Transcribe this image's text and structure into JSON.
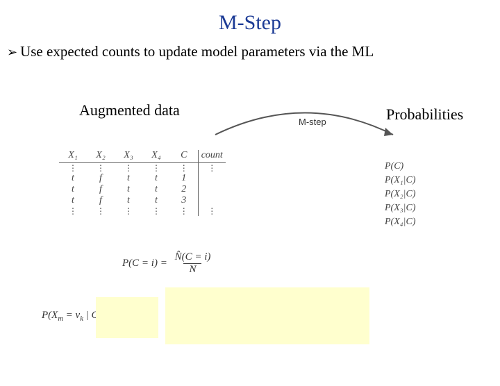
{
  "title": "M-Step",
  "bullet": "Use expected counts to update model parameters via the ML",
  "labels": {
    "augmented": "Augmented data",
    "probabilities": "Probabilities",
    "mstep": "M-step"
  },
  "table": {
    "headers": [
      "X₁",
      "X₂",
      "X₃",
      "X₄",
      "C",
      "count"
    ],
    "rows": [
      [
        "t",
        "f",
        "t",
        "t",
        "1"
      ],
      [
        "t",
        "f",
        "t",
        "t",
        "2"
      ],
      [
        "t",
        "f",
        "t",
        "t",
        "3"
      ]
    ]
  },
  "probs": [
    "P(C)",
    "P(X₁|C)",
    "P(X₂|C)",
    "P(X₃|C)",
    "P(X₄|C)"
  ],
  "formula1": {
    "lhs": "P(C = i) =",
    "num": "N̂(C = i)",
    "den": "N"
  },
  "formula2": {
    "lhs": "P(X",
    "lhs_sub1": "m",
    "mid1": " = v",
    "lhs_sub2": "k",
    "mid2": " | C = i)",
    "eq": "="
  }
}
